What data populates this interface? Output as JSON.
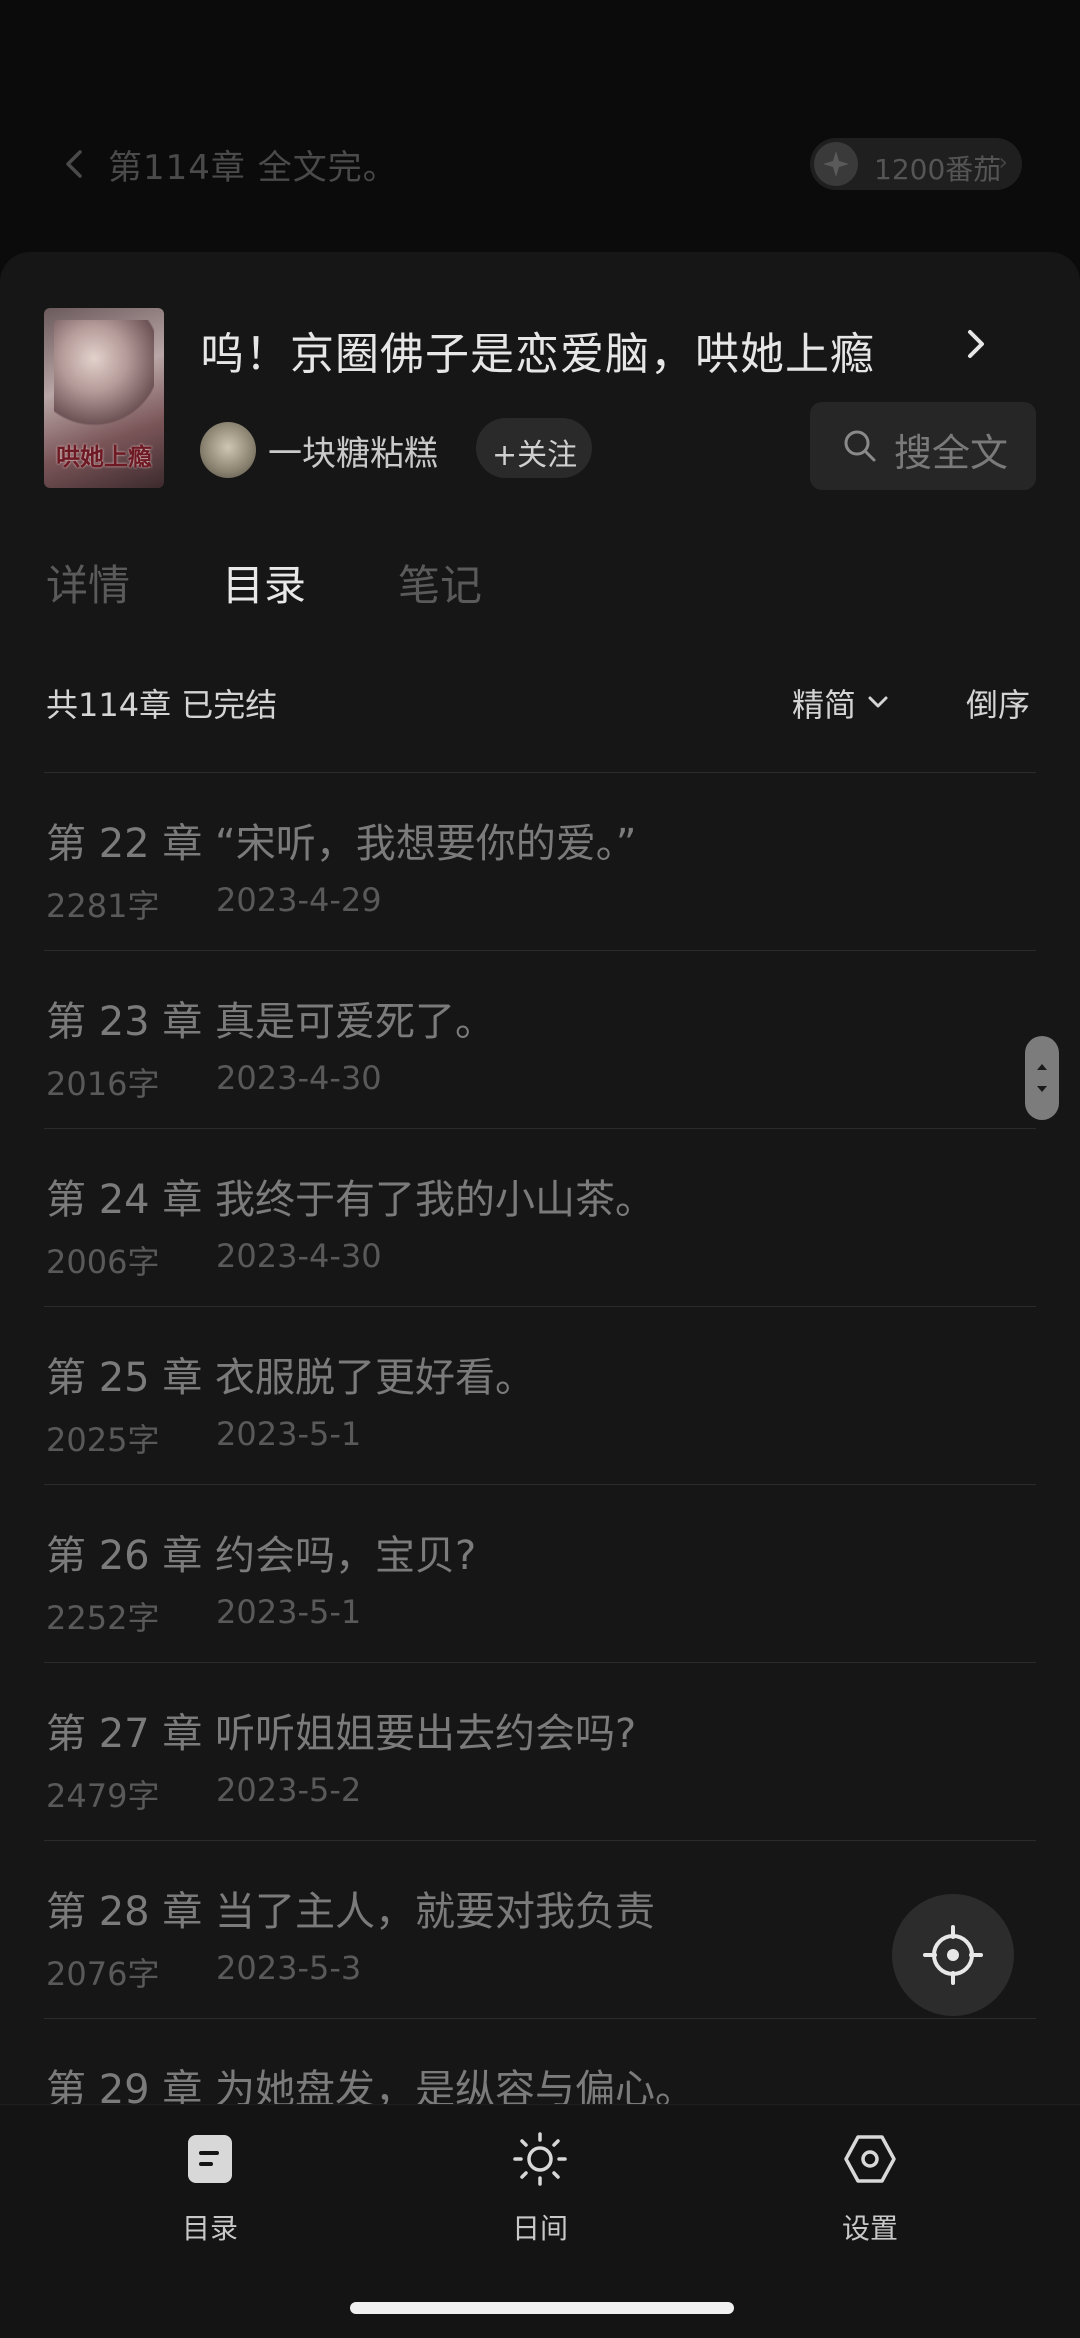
{
  "header": {
    "chapter_title": "第114章 全文完。",
    "coins_label": "1200番茄"
  },
  "book": {
    "cover_title": "哄她上瘾",
    "title": "呜！京圈佛子是恋爱脑，哄她上瘾",
    "author": "一块糖粘糕",
    "follow_label": "+关注",
    "search_label": "搜全文"
  },
  "tabs": [
    {
      "label": "详情",
      "active": false
    },
    {
      "label": "目录",
      "active": true
    },
    {
      "label": "笔记",
      "active": false
    }
  ],
  "catalog": {
    "summary": "共114章 已完结",
    "sort_option": "精简",
    "order_label": "倒序"
  },
  "chapters": [
    {
      "title": "第 22 章 “宋听，我想要你的爱。”",
      "words": "2281字",
      "date": "2023-4-29"
    },
    {
      "title": "第 23 章 真是可爱死了。",
      "words": "2016字",
      "date": "2023-4-30"
    },
    {
      "title": "第 24 章 我终于有了我的小山茶。",
      "words": "2006字",
      "date": "2023-4-30"
    },
    {
      "title": "第 25 章 衣服脱了更好看。",
      "words": "2025字",
      "date": "2023-5-1"
    },
    {
      "title": "第 26 章 约会吗，宝贝?",
      "words": "2252字",
      "date": "2023-5-1"
    },
    {
      "title": "第 27 章 听听姐姐要出去约会吗?",
      "words": "2479字",
      "date": "2023-5-2"
    },
    {
      "title": "第 28 章 当了主人，就要对我负责",
      "words": "2076字",
      "date": "2023-5-3"
    },
    {
      "title": "第 29 章 为她盘发，是纵容与偏心。",
      "words": "",
      "date": ""
    }
  ],
  "bottom_bar": [
    {
      "label": "目录",
      "icon": "catalog-icon"
    },
    {
      "label": "日间",
      "icon": "sun-icon"
    },
    {
      "label": "设置",
      "icon": "settings-icon"
    }
  ],
  "colors": {
    "background": "#0b0b0b",
    "sheet": "#161616",
    "text_primary": "#e6e6e6",
    "text_muted": "#7b7b7b"
  }
}
